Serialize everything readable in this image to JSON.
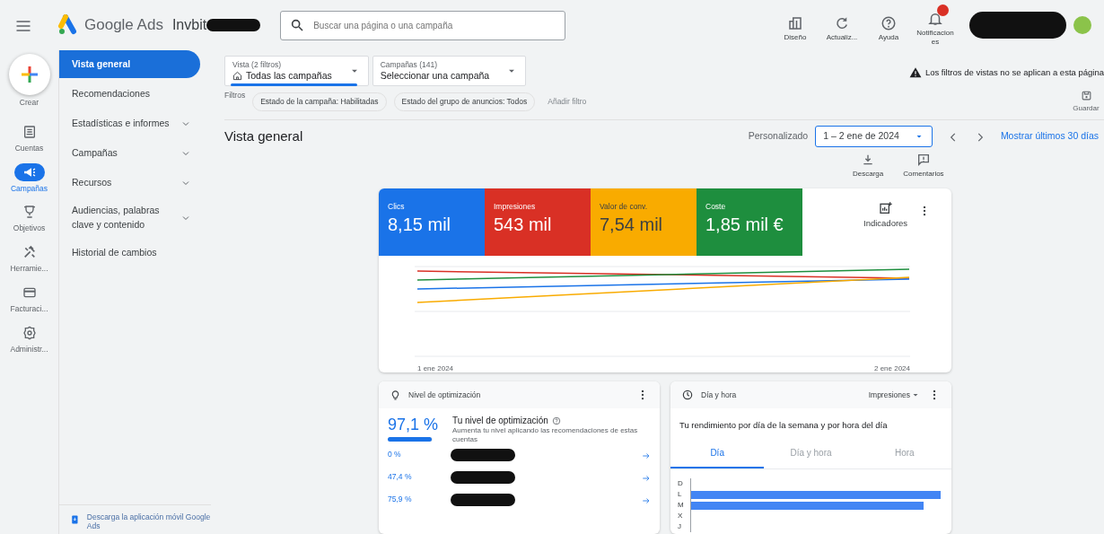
{
  "header": {
    "product": "Google Ads",
    "account": "Invbit",
    "account_redacted": true,
    "search": {
      "placeholder": "Buscar una página o una campaña"
    },
    "actions": [
      {
        "kind": "layout",
        "label": "Diseño",
        "alert": false
      },
      {
        "kind": "refresh",
        "label": "Actualiz...",
        "alert": false
      },
      {
        "kind": "help",
        "label": "Ayuda",
        "alert": false
      },
      {
        "kind": "bell",
        "label": "Notificaciones",
        "alert": true
      }
    ],
    "profile_redacted": true
  },
  "rail": [
    {
      "kind": "create",
      "label": "Crear",
      "selected": false
    },
    {
      "kind": "accounts",
      "label": "Cuentas",
      "selected": false
    },
    {
      "kind": "campaigns",
      "label": "Campañas",
      "selected": true
    },
    {
      "kind": "goals",
      "label": "Objetivos",
      "selected": false
    },
    {
      "kind": "tools",
      "label": "Herramie...",
      "selected": false
    },
    {
      "kind": "billing",
      "label": "Facturaci...",
      "selected": false
    },
    {
      "kind": "admin",
      "label": "Administr...",
      "selected": false
    }
  ],
  "nav": {
    "items": [
      {
        "label": "Vista general",
        "selected": true,
        "expandable": false
      },
      {
        "label": "Recomendaciones",
        "selected": false,
        "expandable": false
      },
      {
        "label": "Estadísticas e informes",
        "selected": false,
        "expandable": true
      },
      {
        "label": "Campañas",
        "selected": false,
        "expandable": true
      },
      {
        "label": "Recursos",
        "selected": false,
        "expandable": true
      },
      {
        "label": "Audiencias, palabras clave y contenido",
        "selected": false,
        "expandable": true
      },
      {
        "label": "Historial de cambios",
        "selected": false,
        "expandable": false
      }
    ],
    "app_link": "Descarga la aplicación móvil Google Ads"
  },
  "filters": {
    "view": {
      "label": "Vista (2 filtros)",
      "value": "Todas las campañas"
    },
    "campaigns": {
      "label": "Campañas (141)",
      "value": "Seleccionar una campaña"
    },
    "warning": "Los filtros de vistas no se aplican a esta página",
    "filters_label": "Filtros",
    "chips": [
      "Estado de la campaña: Habilitadas",
      "Estado del grupo de anuncios: Todos"
    ],
    "add_filter": "Añadir filtro",
    "save": "Guardar"
  },
  "page_title": "Vista general",
  "date": {
    "preset": "Personalizado",
    "range": "1 – 2 ene de 2024",
    "last30": "Mostrar últimos 30 días"
  },
  "tools": [
    "Descarga",
    "Comentarios"
  ],
  "metrics": [
    {
      "label": "Clics",
      "value": "8,15 mil",
      "color": "#1a73e8"
    },
    {
      "label": "Impresiones",
      "value": "543 mil",
      "color": "#d93025"
    },
    {
      "label": "Valor de conv.",
      "value": "7,54 mil",
      "color": "#f9ab00"
    },
    {
      "label": "Coste",
      "value": "1,85 mil €",
      "color": "#1e8e3e"
    }
  ],
  "indicators": "Indicadores",
  "chart_x_labels": [
    "1 ene 2024",
    "2 ene 2024"
  ],
  "optimization": {
    "title": "Nivel de optimización",
    "score": "97,1 %",
    "level": 0.971,
    "heading": "Tu nivel de optimización",
    "text": "Aumenta tu nivel aplicando las recomendaciones de estas cuentas",
    "rows": [
      {
        "value": "0 %",
        "redacted": true
      },
      {
        "value": "47,4 %",
        "redacted": true
      },
      {
        "value": "75,9 %",
        "redacted": true
      }
    ]
  },
  "day_hour": {
    "title": "Día y hora",
    "metric": "Impresiones",
    "subtitle": "Tu rendimiento por día de la semana y por hora del día",
    "tabs": [
      {
        "label": "Día",
        "selected": true
      },
      {
        "label": "Día y hora",
        "selected": false
      },
      {
        "label": "Hora",
        "selected": false
      }
    ],
    "days": [
      "D",
      "L",
      "M",
      "X",
      "J"
    ]
  }
}
